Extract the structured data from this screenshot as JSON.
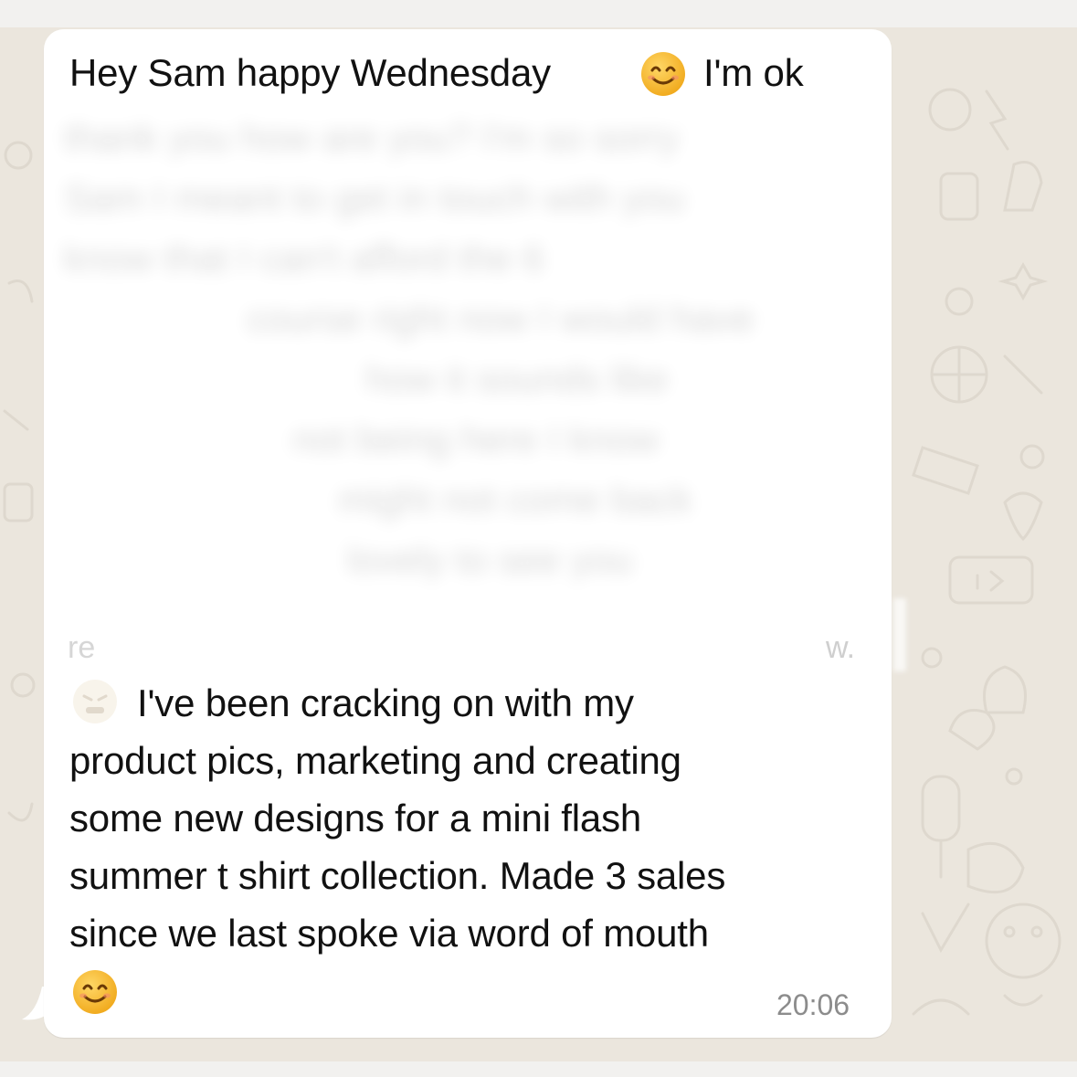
{
  "message": {
    "line1_prefix": "Hey Sam happy Wednesday",
    "line1_suffix": "I'm ok",
    "blurred_lines": [
      "thank you how are you? I'm so sorry",
      "Sam I meant to get in touch with you",
      "know that I can't afford the 6",
      "course right now I would have",
      "how it sounds like",
      "not being here I know",
      "might not come back",
      "lovely to see you"
    ],
    "faded_left": "re",
    "faded_right": "w.",
    "body_lines": [
      "I've been cracking on with my",
      "product pics, marketing and creating",
      "some new designs for a mini flash",
      "summer t shirt collection. Made 3 sales",
      "since we last spoke via word of mouth"
    ],
    "timestamp": "20:06"
  },
  "icons": {
    "smile_emoji": "smiling-face-emoji",
    "faded_emoji": "faded-face-emoji"
  },
  "colors": {
    "bubble": "#ffffff",
    "wallpaper": "#ebe6dd",
    "emoji_face": "#f7b924",
    "timestamp": "#8c8c8c"
  }
}
